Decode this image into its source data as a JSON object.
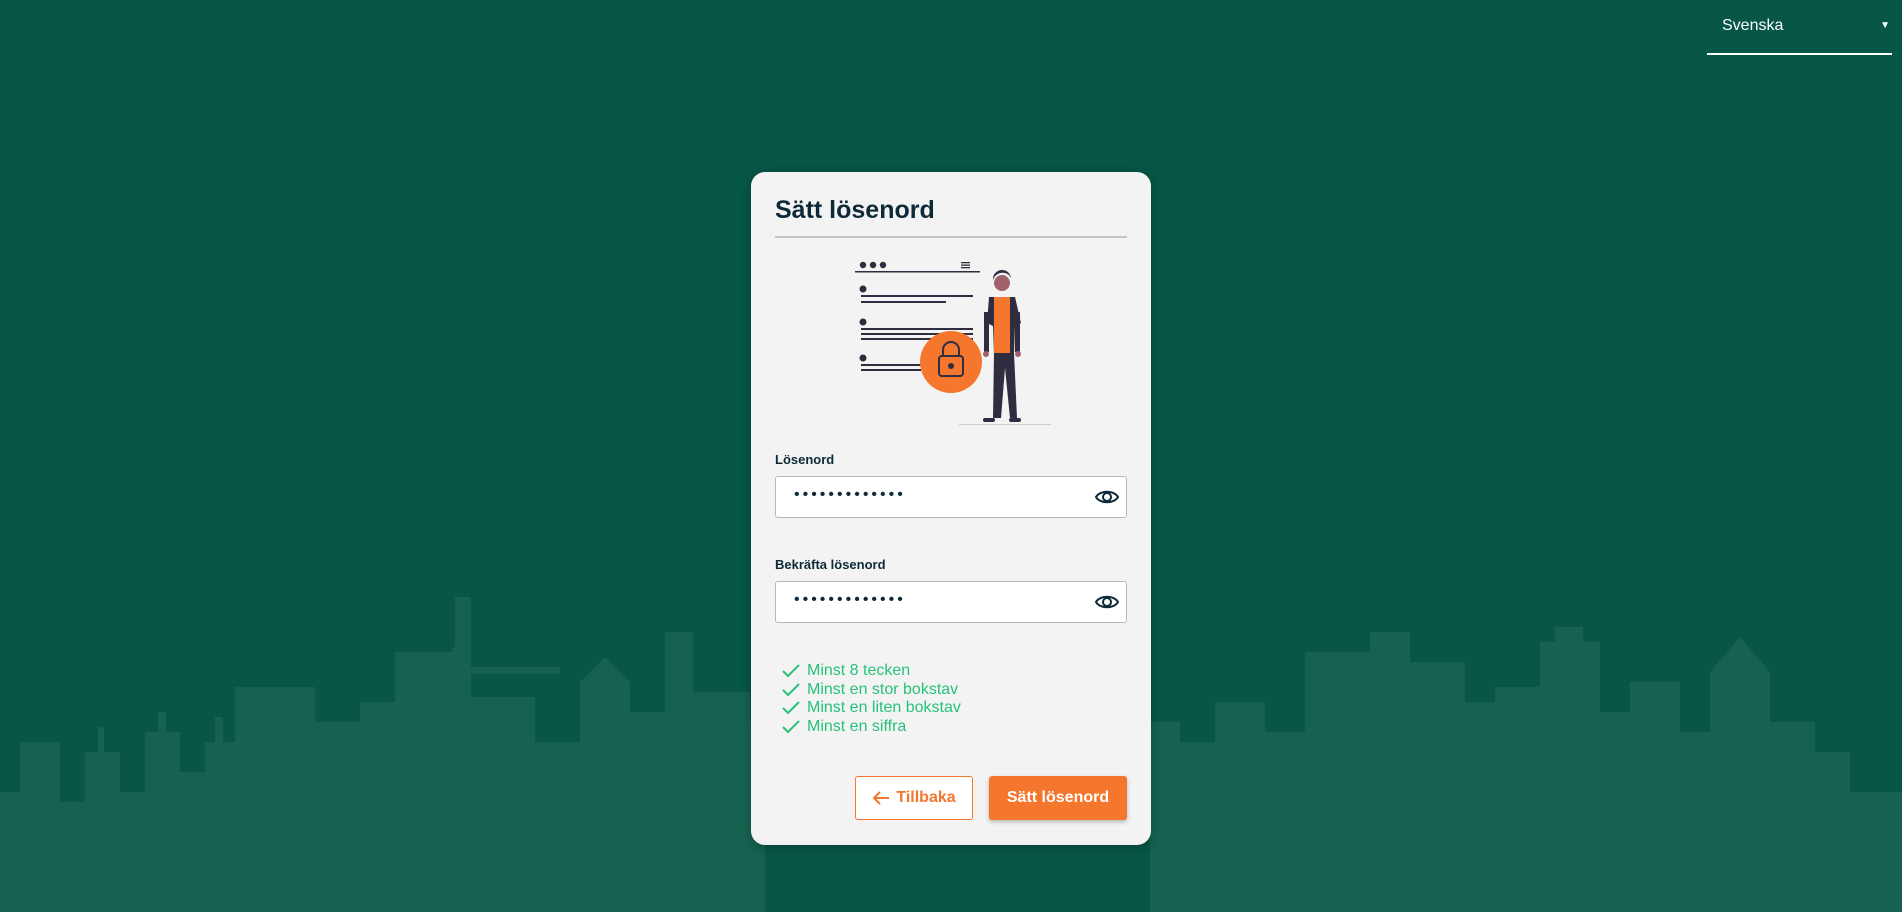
{
  "language_select": {
    "value": "Svenska"
  },
  "card": {
    "title": "Sätt lösenord",
    "password": {
      "label": "Lösenord",
      "masked_value": "•••••••••••••"
    },
    "confirm_password": {
      "label": "Bekräfta lösenord",
      "masked_value": "•••••••••••••"
    },
    "requirements": [
      {
        "text": "Minst 8 tecken",
        "met": true
      },
      {
        "text": "Minst en stor bokstav",
        "met": true
      },
      {
        "text": "Minst en liten bokstav",
        "met": true
      },
      {
        "text": "Minst en siffra",
        "met": true
      }
    ],
    "back_button": "Tillbaka",
    "submit_button": "Sätt lösenord"
  },
  "colors": {
    "background": "#075646",
    "skyline": "#16614f",
    "accent": "#f5762d",
    "success": "#27c27a",
    "text_dark": "#0e2a38"
  },
  "icons": [
    "chevron-down-icon",
    "eye-icon",
    "checkmark-icon",
    "arrow-left-icon",
    "padlock-icon"
  ]
}
